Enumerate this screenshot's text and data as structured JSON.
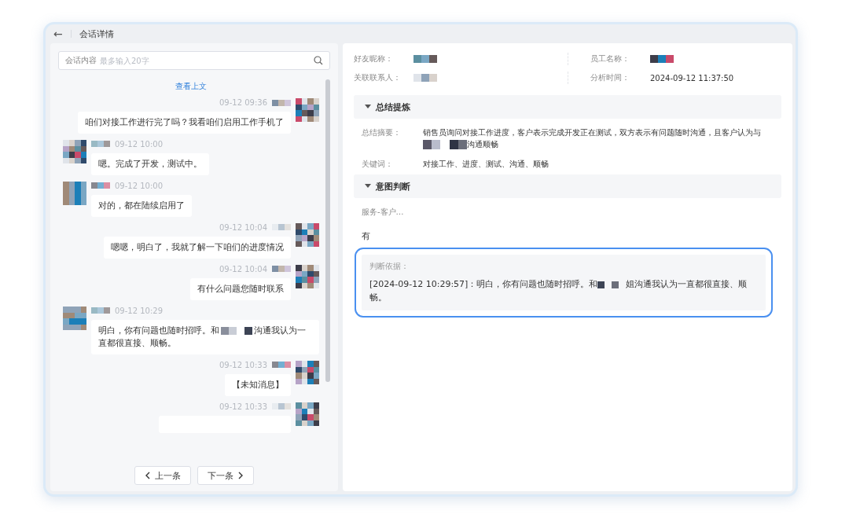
{
  "window": {
    "title": "会话详情",
    "back": "←"
  },
  "search": {
    "label": "会话内容",
    "placeholder": "最多输入20字"
  },
  "load_more": "查看上文",
  "messages": [
    {
      "kind": "outgoing",
      "time": "09-12 09:36",
      "text": "咱们对接工作进行完了吗？我看咱们启用工作手机了"
    },
    {
      "kind": "incoming",
      "time": "09-12 10:00",
      "text": "嗯。完成了开发，测试中。"
    },
    {
      "kind": "incoming",
      "time": "09-12 10:00",
      "text": "对的，都在陆续启用了"
    },
    {
      "kind": "outgoing",
      "time": "09-12 10:04",
      "text": "嗯嗯，明白了，我就了解一下咱们的进度情况"
    },
    {
      "kind": "outgoing",
      "time": "09-12 10:04",
      "text": "有什么问题您随时联系"
    },
    {
      "kind": "incoming",
      "time": "09-12 10:29",
      "text": "明白，你有问题也随时招呼。和",
      "text_after": "沟通我认为一直都很直接、顺畅。"
    },
    {
      "kind": "outgoing",
      "time": "09-12 10:33",
      "text": "【未知消息】"
    },
    {
      "kind": "outgoing",
      "time": "09-12 10:33"
    }
  ],
  "pager": {
    "prev": "上一条",
    "next": "下一条"
  },
  "info": [
    {
      "label": "好友昵称：",
      "redacted": true
    },
    {
      "label": "员工名称：",
      "redacted": true
    },
    {
      "label": "关联联系人：",
      "redacted": true
    },
    {
      "label": "分析时间：",
      "value": "2024-09-12 11:37:50"
    }
  ],
  "sections": [
    {
      "title": "总结提炼",
      "expanded": true,
      "rows": [
        {
          "kind": "text",
          "label": "总结摘要：",
          "text": "销售员询问对接工作进度，客户表示完成开发正在测试，双方表示有问题随时沟通，且客户认为与",
          "text_after": "沟通顺畅"
        },
        {
          "kind": "text",
          "label": "关键词：",
          "text": "对接工作、进度、测试、沟通、顺畅"
        }
      ]
    },
    {
      "title": "意图判断",
      "expanded": true,
      "rows": [
        {
          "kind": "intent",
          "label": "服务-客户…",
          "value": "有",
          "evidence_label": "判断依据：",
          "text": "[2024-09-12 10:29:57]：明白，你有问题也随时招呼。和",
          "text_after": "姐沟通我认为一直都很直接、顺畅。",
          "highlighted": true
        }
      ]
    }
  ]
}
